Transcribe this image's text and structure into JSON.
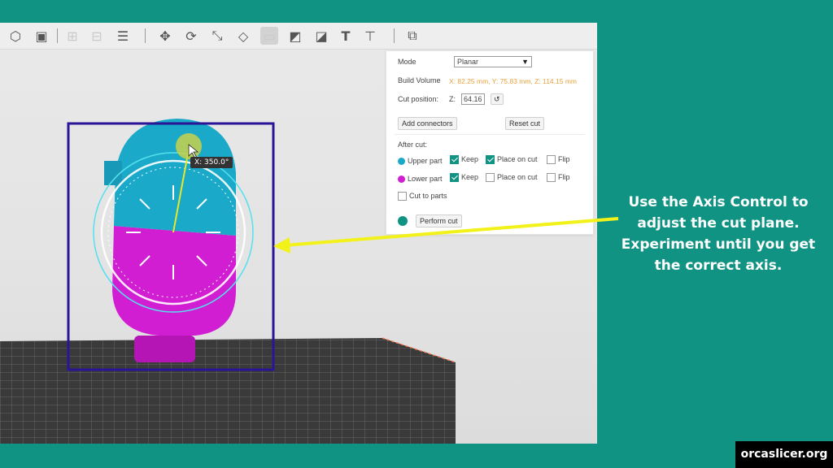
{
  "toolbar": {
    "icons": [
      {
        "name": "arrange-icon",
        "glyph": "⬡",
        "faded": false
      },
      {
        "name": "orient-icon",
        "glyph": "▣",
        "faded": false
      },
      {
        "name": "split-objects-icon",
        "glyph": "⊞",
        "faded": true
      },
      {
        "name": "split-parts-icon",
        "glyph": "⊟",
        "faded": true
      },
      {
        "name": "layers-icon",
        "glyph": "☰",
        "faded": false
      },
      {
        "name": "move-icon",
        "glyph": "✥",
        "faded": false
      },
      {
        "name": "rotate-icon",
        "glyph": "⟳",
        "faded": false
      },
      {
        "name": "scale-icon",
        "glyph": "⤡",
        "faded": false
      },
      {
        "name": "lay-on-face-icon",
        "glyph": "◇",
        "faded": false
      },
      {
        "name": "cut-icon",
        "glyph": "▭",
        "faded": true
      },
      {
        "name": "support-paint-icon",
        "glyph": "◩",
        "faded": false
      },
      {
        "name": "seam-paint-icon",
        "glyph": "◪",
        "faded": false
      },
      {
        "name": "text-icon",
        "glyph": "T",
        "faded": false
      },
      {
        "name": "measure-icon",
        "glyph": "⊤",
        "faded": false
      },
      {
        "name": "assembly-icon",
        "glyph": "⧉",
        "faded": false
      }
    ]
  },
  "cut_panel": {
    "mode_label": "Mode",
    "mode_value": "Planar",
    "dropdown_arrow": "▼",
    "build_volume_label": "Build Volume",
    "build_volume_value": "X: 82.25 mm, Y: 75.83 mm, Z: 114.15 mm",
    "cut_position_label": "Cut position:",
    "cut_axis": "Z:",
    "cut_value": "64.16",
    "reset_glyph": "↺",
    "add_connectors": "Add connectors",
    "reset_cut": "Reset cut",
    "after_cut_label": "After cut:",
    "upper_part": "Upper part",
    "lower_part": "Lower part",
    "keep": "Keep",
    "place_on_cut": "Place on cut",
    "flip": "Flip",
    "cut_to_parts": "Cut to parts",
    "perform_cut": "Perform cut",
    "upper_keep": true,
    "upper_place_on_cut": true,
    "upper_flip": false,
    "lower_keep": true,
    "lower_place_on_cut": false,
    "lower_flip": false,
    "cut_to_parts_checked": false
  },
  "rotation_tooltip": "X: 350.0°",
  "callout_text": "Use the Axis Control to adjust the cut plane. Experiment until you get the correct axis.",
  "footer_badge": "orcaslicer.org",
  "colors": {
    "background": "#119383",
    "upper_part": "#1aa9c8",
    "lower_part": "#d21ed2",
    "selection_box": "#2b1496",
    "arrow": "#f2f21a",
    "accent_orange": "#e6a23c"
  }
}
